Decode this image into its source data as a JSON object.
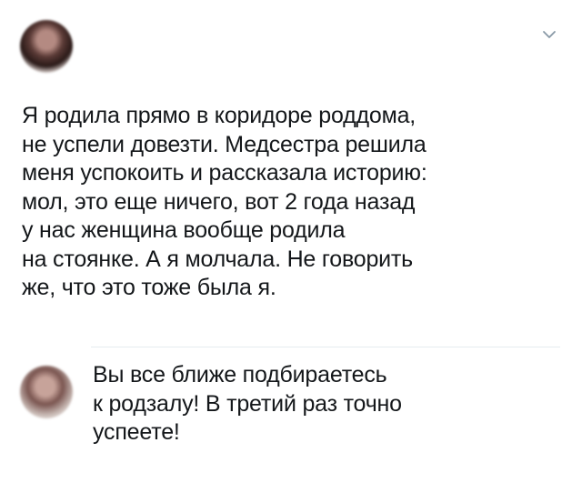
{
  "tweet": {
    "author_name": "",
    "author_handle": "",
    "lines": [
      "Я родила прямо в коридоре роддома,",
      "не успели довезти. Медсестра решила",
      "меня успокоить и рассказала историю:",
      "мол, это еще ничего, вот 2 года назад",
      "у нас женщина вообще родила",
      "на стоянке. А я молчала. Не говорить",
      "же, что это тоже была я."
    ]
  },
  "reply": {
    "lines": [
      "Вы все ближе подбираетесь",
      "к родзалу! В третий раз точно",
      "успеете!"
    ]
  },
  "icons": {
    "menu": "chevron-down-icon"
  },
  "colors": {
    "text": "#14171a",
    "divider": "#e6ecf0",
    "chevron": "#8899a6"
  }
}
